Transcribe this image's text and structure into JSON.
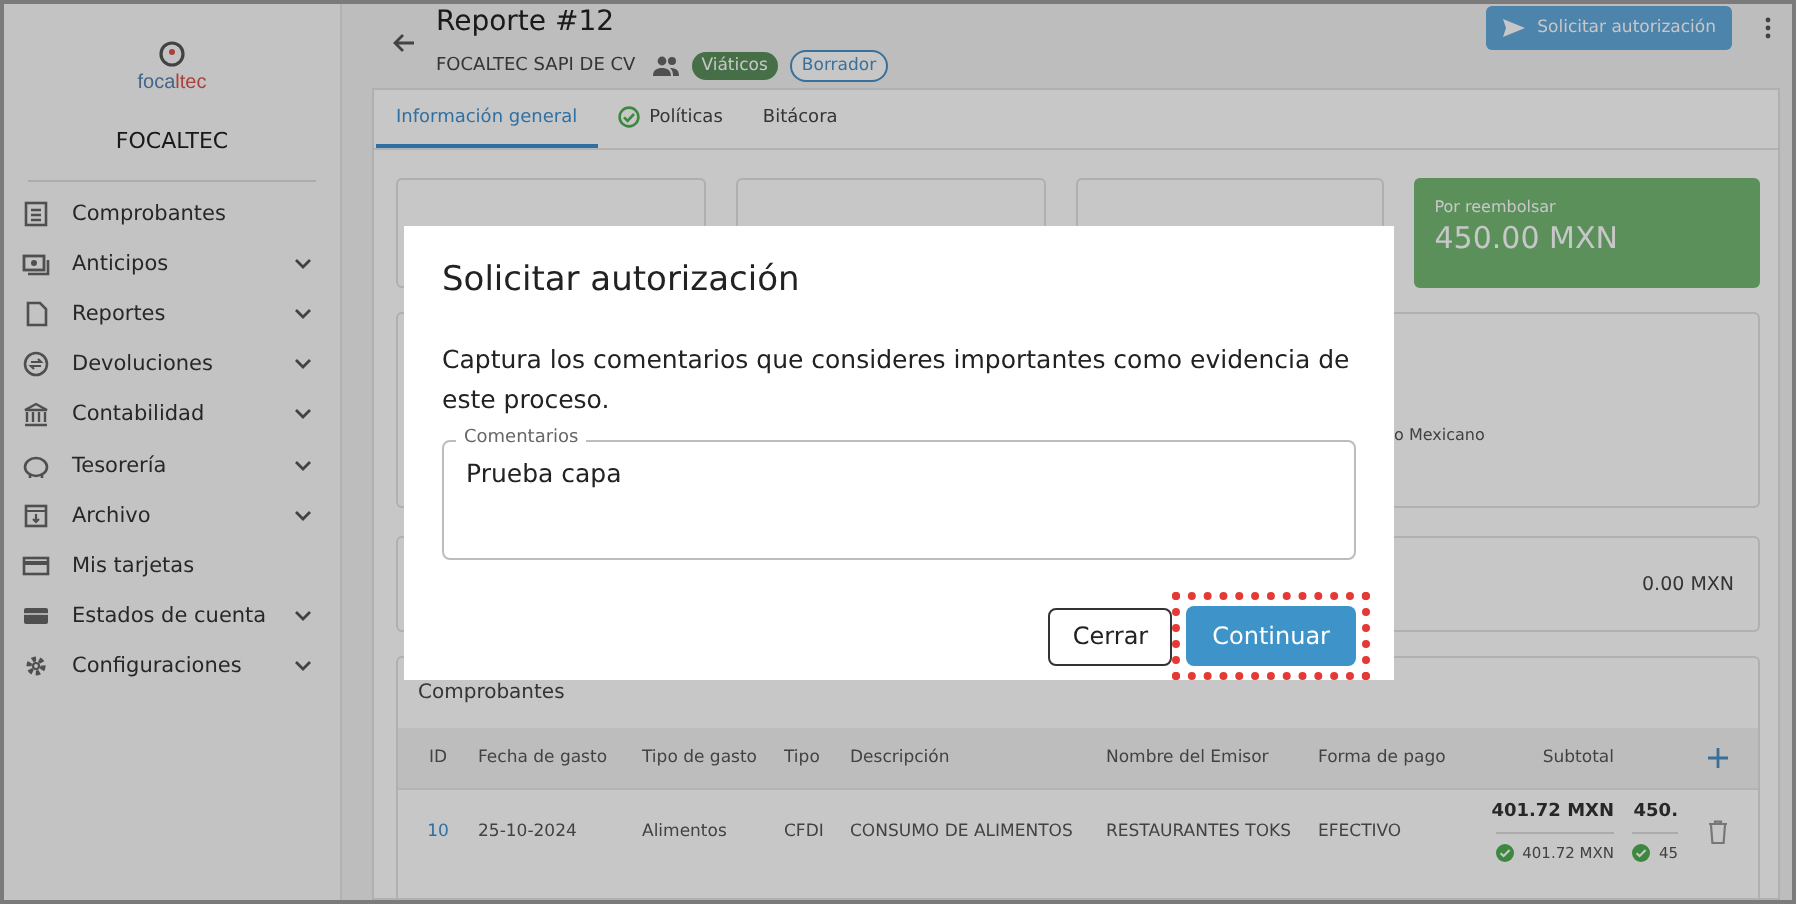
{
  "sidebar": {
    "logo": [
      "foca",
      "ltec"
    ],
    "company": "FOCALTEC",
    "items": [
      {
        "label": "Comprobantes",
        "expandable": false
      },
      {
        "label": "Anticipos",
        "expandable": true
      },
      {
        "label": "Reportes",
        "expandable": true
      },
      {
        "label": "Devoluciones",
        "expandable": true
      },
      {
        "label": "Contabilidad",
        "expandable": true
      },
      {
        "label": "Tesorería",
        "expandable": true
      },
      {
        "label": "Archivo",
        "expandable": true
      },
      {
        "label": "Mis tarjetas",
        "expandable": false
      },
      {
        "label": "Estados de cuenta",
        "expandable": true
      },
      {
        "label": "Configuraciones",
        "expandable": true
      }
    ]
  },
  "header": {
    "title": "Reporte #12",
    "company": "FOCALTEC SAPI DE CV",
    "tags": [
      {
        "label": "Viáticos",
        "kind": "filled"
      },
      {
        "label": "Borrador",
        "kind": "outlined"
      }
    ],
    "action": "Solicitar autorización"
  },
  "tabs": [
    {
      "label": "Información general",
      "selected": true,
      "checked": false
    },
    {
      "label": "Políticas",
      "selected": false,
      "checked": true
    },
    {
      "label": "Bitácora",
      "selected": false,
      "checked": false
    }
  ],
  "summary": {
    "label": "Por reembolsar",
    "amount": "450.00 MXN"
  },
  "details": {
    "partial_text": "o Mexicano",
    "total": "0.00 MXN"
  },
  "comprobantes": {
    "title": "Comprobantes",
    "columns": [
      "ID",
      "Fecha de gasto",
      "Tipo de gasto",
      "Tipo",
      "Descripción",
      "Nombre del Emisor",
      "Forma de pago",
      "Subtotal"
    ],
    "rows": [
      {
        "id": "10",
        "fecha": "25-10-2024",
        "tipo_gasto": "Alimentos",
        "tipo": "CFDI",
        "descripcion": "CONSUMO DE ALIMENTOS",
        "emisor": "RESTAURANTES TOKS",
        "forma_pago": "EFECTIVO",
        "subtotal": "401.72 MXN",
        "subtotal_check": "401.72 MXN",
        "column_9": "450.",
        "column_9_check": "45"
      }
    ]
  },
  "dialog": {
    "title": "Solicitar autorización",
    "message": "Captura los comentarios que consideres importantes como evidencia de este proceso.",
    "field": {
      "label": "Comentarios",
      "value": "Prueba capa"
    },
    "buttons": [
      {
        "label": "Cerrar",
        "kind": "outlined"
      },
      {
        "label": "Continuar",
        "kind": "primary",
        "highlighted": true
      }
    ]
  }
}
